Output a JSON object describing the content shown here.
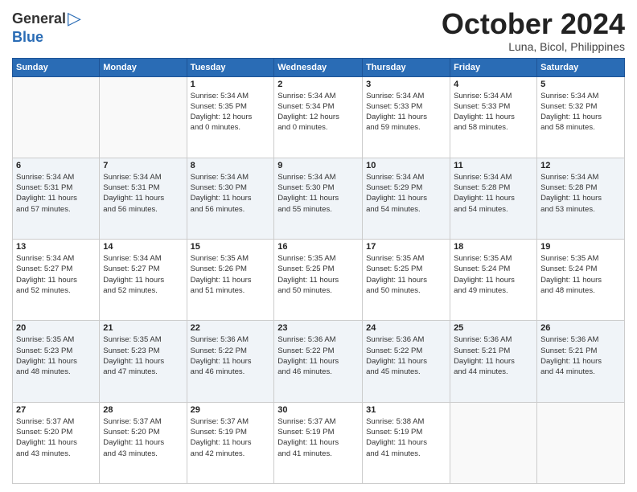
{
  "logo": {
    "general": "General",
    "blue": "Blue"
  },
  "title": "October 2024",
  "location": "Luna, Bicol, Philippines",
  "days_header": [
    "Sunday",
    "Monday",
    "Tuesday",
    "Wednesday",
    "Thursday",
    "Friday",
    "Saturday"
  ],
  "weeks": [
    [
      {
        "day": "",
        "detail": ""
      },
      {
        "day": "",
        "detail": ""
      },
      {
        "day": "1",
        "detail": "Sunrise: 5:34 AM\nSunset: 5:35 PM\nDaylight: 12 hours\nand 0 minutes."
      },
      {
        "day": "2",
        "detail": "Sunrise: 5:34 AM\nSunset: 5:34 PM\nDaylight: 12 hours\nand 0 minutes."
      },
      {
        "day": "3",
        "detail": "Sunrise: 5:34 AM\nSunset: 5:33 PM\nDaylight: 11 hours\nand 59 minutes."
      },
      {
        "day": "4",
        "detail": "Sunrise: 5:34 AM\nSunset: 5:33 PM\nDaylight: 11 hours\nand 58 minutes."
      },
      {
        "day": "5",
        "detail": "Sunrise: 5:34 AM\nSunset: 5:32 PM\nDaylight: 11 hours\nand 58 minutes."
      }
    ],
    [
      {
        "day": "6",
        "detail": "Sunrise: 5:34 AM\nSunset: 5:31 PM\nDaylight: 11 hours\nand 57 minutes."
      },
      {
        "day": "7",
        "detail": "Sunrise: 5:34 AM\nSunset: 5:31 PM\nDaylight: 11 hours\nand 56 minutes."
      },
      {
        "day": "8",
        "detail": "Sunrise: 5:34 AM\nSunset: 5:30 PM\nDaylight: 11 hours\nand 56 minutes."
      },
      {
        "day": "9",
        "detail": "Sunrise: 5:34 AM\nSunset: 5:30 PM\nDaylight: 11 hours\nand 55 minutes."
      },
      {
        "day": "10",
        "detail": "Sunrise: 5:34 AM\nSunset: 5:29 PM\nDaylight: 11 hours\nand 54 minutes."
      },
      {
        "day": "11",
        "detail": "Sunrise: 5:34 AM\nSunset: 5:28 PM\nDaylight: 11 hours\nand 54 minutes."
      },
      {
        "day": "12",
        "detail": "Sunrise: 5:34 AM\nSunset: 5:28 PM\nDaylight: 11 hours\nand 53 minutes."
      }
    ],
    [
      {
        "day": "13",
        "detail": "Sunrise: 5:34 AM\nSunset: 5:27 PM\nDaylight: 11 hours\nand 52 minutes."
      },
      {
        "day": "14",
        "detail": "Sunrise: 5:34 AM\nSunset: 5:27 PM\nDaylight: 11 hours\nand 52 minutes."
      },
      {
        "day": "15",
        "detail": "Sunrise: 5:35 AM\nSunset: 5:26 PM\nDaylight: 11 hours\nand 51 minutes."
      },
      {
        "day": "16",
        "detail": "Sunrise: 5:35 AM\nSunset: 5:25 PM\nDaylight: 11 hours\nand 50 minutes."
      },
      {
        "day": "17",
        "detail": "Sunrise: 5:35 AM\nSunset: 5:25 PM\nDaylight: 11 hours\nand 50 minutes."
      },
      {
        "day": "18",
        "detail": "Sunrise: 5:35 AM\nSunset: 5:24 PM\nDaylight: 11 hours\nand 49 minutes."
      },
      {
        "day": "19",
        "detail": "Sunrise: 5:35 AM\nSunset: 5:24 PM\nDaylight: 11 hours\nand 48 minutes."
      }
    ],
    [
      {
        "day": "20",
        "detail": "Sunrise: 5:35 AM\nSunset: 5:23 PM\nDaylight: 11 hours\nand 48 minutes."
      },
      {
        "day": "21",
        "detail": "Sunrise: 5:35 AM\nSunset: 5:23 PM\nDaylight: 11 hours\nand 47 minutes."
      },
      {
        "day": "22",
        "detail": "Sunrise: 5:36 AM\nSunset: 5:22 PM\nDaylight: 11 hours\nand 46 minutes."
      },
      {
        "day": "23",
        "detail": "Sunrise: 5:36 AM\nSunset: 5:22 PM\nDaylight: 11 hours\nand 46 minutes."
      },
      {
        "day": "24",
        "detail": "Sunrise: 5:36 AM\nSunset: 5:22 PM\nDaylight: 11 hours\nand 45 minutes."
      },
      {
        "day": "25",
        "detail": "Sunrise: 5:36 AM\nSunset: 5:21 PM\nDaylight: 11 hours\nand 44 minutes."
      },
      {
        "day": "26",
        "detail": "Sunrise: 5:36 AM\nSunset: 5:21 PM\nDaylight: 11 hours\nand 44 minutes."
      }
    ],
    [
      {
        "day": "27",
        "detail": "Sunrise: 5:37 AM\nSunset: 5:20 PM\nDaylight: 11 hours\nand 43 minutes."
      },
      {
        "day": "28",
        "detail": "Sunrise: 5:37 AM\nSunset: 5:20 PM\nDaylight: 11 hours\nand 43 minutes."
      },
      {
        "day": "29",
        "detail": "Sunrise: 5:37 AM\nSunset: 5:19 PM\nDaylight: 11 hours\nand 42 minutes."
      },
      {
        "day": "30",
        "detail": "Sunrise: 5:37 AM\nSunset: 5:19 PM\nDaylight: 11 hours\nand 41 minutes."
      },
      {
        "day": "31",
        "detail": "Sunrise: 5:38 AM\nSunset: 5:19 PM\nDaylight: 11 hours\nand 41 minutes."
      },
      {
        "day": "",
        "detail": ""
      },
      {
        "day": "",
        "detail": ""
      }
    ]
  ]
}
